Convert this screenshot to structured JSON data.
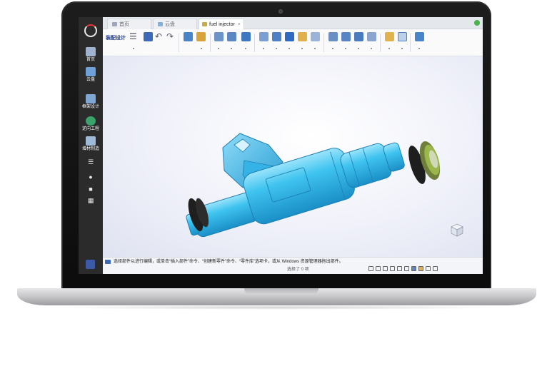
{
  "app": {
    "sidebar": {
      "items": [
        {
          "label": "首页",
          "icon": "home-icon"
        },
        {
          "label": "云盘",
          "icon": "cloud-drive-icon"
        },
        {
          "label": "框架设计",
          "icon": "frame-design-icon"
        },
        {
          "label": "逆向工程",
          "icon": "reverse-engineering-icon"
        },
        {
          "label": "增材制造",
          "icon": "additive-manufacturing-icon"
        }
      ],
      "tools": [
        "sliders-icon",
        "bell-icon",
        "user-icon",
        "grid-icon"
      ],
      "bottom_icon": "book-icon"
    },
    "tabs": [
      {
        "label": "首页",
        "icon": "home-icon"
      },
      {
        "label": "云盘",
        "icon": "cloud-icon"
      },
      {
        "label": "fuel injector",
        "icon": "assembly-icon",
        "close": "×"
      }
    ],
    "ribbon": {
      "title": "装配设计",
      "undo_glyph": "↶",
      "redo_glyph": "↷",
      "menu_glyph": "☰"
    },
    "status": {
      "message": "选择部件以进行编辑，或单击“插入部件”命令、“创建新零件”命令、“零件库”选项卡，或从 Windows 资源管理器拖出部件。",
      "selection": "选择了 0 项"
    },
    "colors": {
      "sidebar": "#2b2b2b",
      "ribbon_title": "#1f3a93",
      "model_body": "#2ab3e6",
      "o_ring": "#202020",
      "filter_ring": "#8bc34a"
    }
  }
}
